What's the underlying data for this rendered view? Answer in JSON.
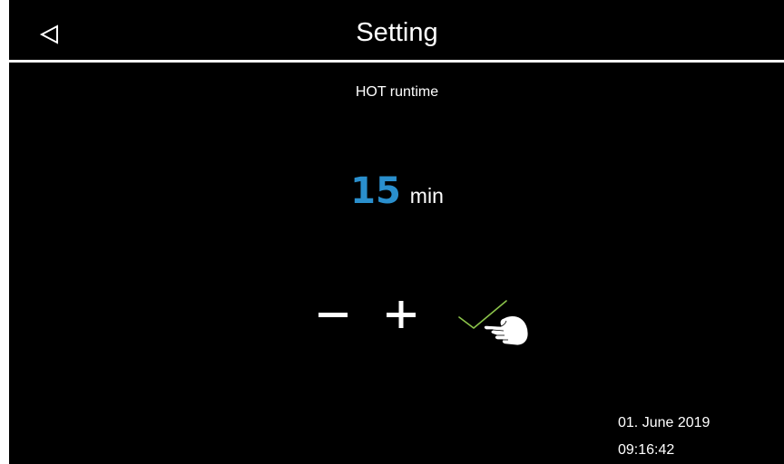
{
  "header": {
    "title": "Setting",
    "back_icon": "back-triangle-icon"
  },
  "parameter": {
    "label": "HOT runtime",
    "value": "15",
    "unit": "min"
  },
  "controls": {
    "minus_icon": "minus-icon",
    "plus_icon": "plus-icon",
    "confirm_icon": "checkmark-icon",
    "pointer_icon": "hand-pointer-icon"
  },
  "status": {
    "date": "01. June 2019",
    "time": "09:16:42"
  },
  "colors": {
    "background": "#000000",
    "text": "#ffffff",
    "value_accent": "#2a8fcd",
    "confirm_accent": "#8bc34a"
  }
}
